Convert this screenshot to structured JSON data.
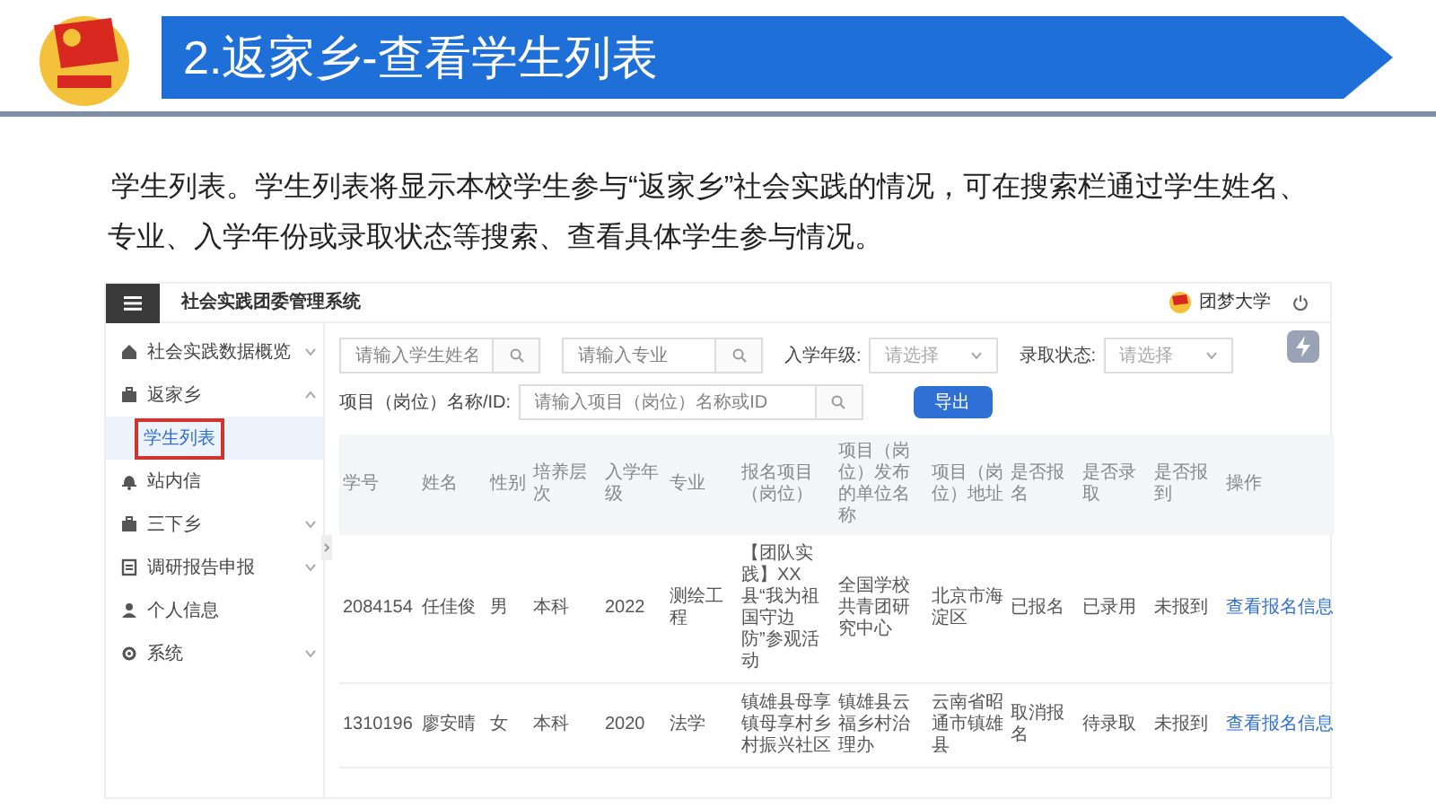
{
  "slide": {
    "title": "2.返家乡-查看学生列表",
    "paragraph": "学生列表。学生列表将显示本校学生参与“返家乡”社会实践的情况，可在搜索栏通过学生姓名、专业、入学年份或录取状态等搜索、查看具体学生参与情况。"
  },
  "app": {
    "title": "社会实践团委管理系统",
    "user": "团梦大学",
    "sidebar": [
      {
        "label": "社会实践数据概览",
        "expanded": false
      },
      {
        "label": "返家乡",
        "expanded": true,
        "children": [
          {
            "label": "学生列表",
            "selected": true
          }
        ]
      },
      {
        "label": "站内信"
      },
      {
        "label": "三下乡",
        "expanded": false
      },
      {
        "label": "调研报告申报",
        "expanded": false
      },
      {
        "label": "个人信息"
      },
      {
        "label": "系统",
        "expanded": false
      }
    ],
    "search_fields": [
      {
        "placeholder": "请输入学生姓名"
      },
      {
        "placeholder": "请输入专业"
      }
    ],
    "selects": [
      {
        "label": "入学年级:",
        "placeholder": "请选择"
      },
      {
        "label": "录取状态:",
        "placeholder": "请选择"
      }
    ],
    "project_field": {
      "label": "项目（岗位）名称/ID:",
      "placeholder": "请输入项目（岗位）名称或ID"
    },
    "export_button": "导出",
    "table": {
      "columns": [
        "学号",
        "姓名",
        "性别",
        "培养层次",
        "入学年级",
        "专业",
        "报名项目（岗位）",
        "项目（岗位）发布的单位名称",
        "项目（岗位）地址",
        "是否报名",
        "是否录取",
        "是否报到",
        "操作"
      ],
      "rows": [
        [
          "2084154",
          "任佳俊",
          "男",
          "本科",
          "2022",
          "测绘工程",
          "【团队实践】XX县“我为祖国守边防”参观活动",
          "全国学校共青团研究中心",
          "北京市海淀区",
          "已报名",
          "已录用",
          "未报到",
          "查看报名信息"
        ],
        [
          "1310196",
          "廖安晴",
          "女",
          "本科",
          "2020",
          "法学",
          "镇雄县母享镇母享村乡村振兴社区",
          "镇雄县云福乡村治理办",
          "云南省昭通市镇雄县",
          "取消报名",
          "待录取",
          "未报到",
          "查看报名信息"
        ]
      ]
    }
  }
}
